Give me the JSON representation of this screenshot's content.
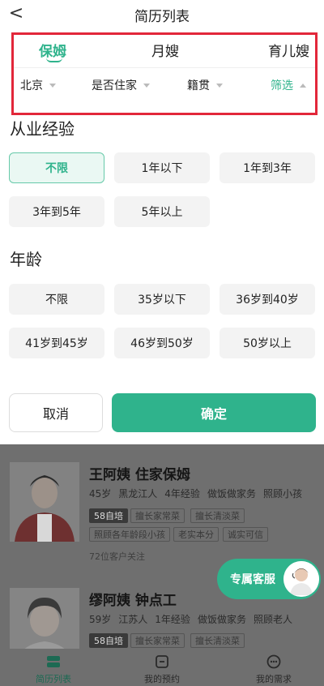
{
  "header": {
    "title": "简历列表",
    "back": "<"
  },
  "tabs": [
    {
      "label": "保姆",
      "active": true
    },
    {
      "label": "月嫂",
      "active": false
    },
    {
      "label": "育儿嫂",
      "active": false
    }
  ],
  "dropdowns": [
    {
      "label": "北京"
    },
    {
      "label": "是否住家"
    },
    {
      "label": "籍贯"
    },
    {
      "label": "筛选",
      "active": true
    }
  ],
  "experience": {
    "title": "从业经验",
    "options": [
      "不限",
      "1年以下",
      "1年到3年",
      "3年到5年",
      "5年以上"
    ],
    "selected": "不限"
  },
  "age": {
    "title": "年龄",
    "options": [
      "不限",
      "35岁以下",
      "36岁到40岁",
      "41岁到45岁",
      "46岁到50岁",
      "50岁以上"
    ]
  },
  "actions": {
    "cancel": "取消",
    "confirm": "确定"
  },
  "cards": [
    {
      "name": "王阿姨 住家保姆",
      "meta": [
        "45岁",
        "黑龙江人",
        "4年经验",
        "做饭做家务",
        "照顾小孩"
      ],
      "tags_row1": [
        "58自培",
        "擅长家常菜",
        "擅长清淡菜"
      ],
      "tags_row2": [
        "照顾各年龄段小孩",
        "老实本分",
        "诚实可信"
      ],
      "follow": "72位客户关注"
    },
    {
      "name": "缪阿姨 钟点工",
      "meta": [
        "59岁",
        "江苏人",
        "1年经验",
        "做饭做家务",
        "照顾老人"
      ],
      "tags_row1": [
        "58自培",
        "擅长家常菜",
        "擅长清淡菜"
      ]
    }
  ],
  "service": {
    "label": "专属客服"
  },
  "bottom_nav": [
    {
      "label": "简历列表",
      "active": true
    },
    {
      "label": "我的预约",
      "active": false
    },
    {
      "label": "我的需求",
      "active": false
    }
  ],
  "colors": {
    "accent": "#2fb38c",
    "highlight_border": "#e2273a",
    "overlay": "#6f6f6f"
  }
}
